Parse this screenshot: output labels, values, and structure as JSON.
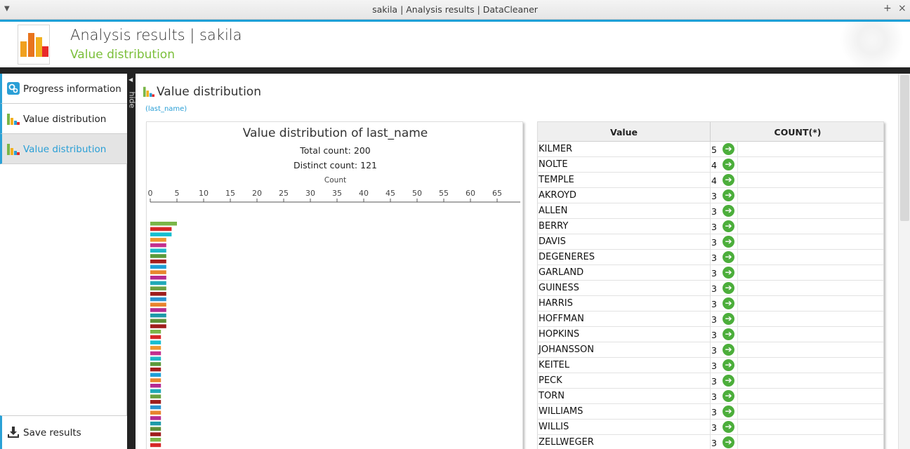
{
  "window": {
    "title": "sakila | Analysis results | DataCleaner",
    "controls": [
      "+",
      "×"
    ]
  },
  "header": {
    "title": "Analysis results  |  sakila",
    "subtitle": "Value distribution"
  },
  "sidebar": {
    "items": [
      {
        "label": "Progress information",
        "icon": "progress-gears-icon"
      },
      {
        "label": "Value distribution",
        "icon": "bar-chart-icon"
      },
      {
        "label": "Value distribution",
        "icon": "bar-chart-icon",
        "active": true
      }
    ],
    "save_label": "Save results",
    "hide_label": "hide"
  },
  "section": {
    "title": "Value distribution",
    "column_link": "(last_name)"
  },
  "chart_data": {
    "type": "bar",
    "orientation": "horizontal",
    "title": "Value distribution of last_name",
    "subtitle_total": "Total count: 200",
    "subtitle_distinct": "Distinct count: 121",
    "xlabel": "Count",
    "xlim": [
      0,
      70
    ],
    "xticks": [
      0,
      5,
      10,
      15,
      20,
      25,
      30,
      35,
      40,
      45,
      50,
      55,
      60,
      65
    ],
    "values": [
      5,
      4,
      4,
      3,
      3,
      3,
      3,
      3,
      3,
      3,
      3,
      3,
      3,
      3,
      3,
      3,
      3,
      3,
      3,
      3,
      2,
      2,
      2,
      2,
      2,
      2,
      2,
      2,
      2,
      2,
      2,
      2,
      2,
      2,
      2,
      2,
      2,
      2,
      2,
      2,
      2,
      2
    ],
    "colors": [
      "#7ab648",
      "#d62728",
      "#17becf",
      "#f0962e",
      "#c3308f",
      "#1fb6c8",
      "#5b9a3a",
      "#a61e1e",
      "#1f9fd6",
      "#e8862e",
      "#b52a92",
      "#21a9b8",
      "#6aa040",
      "#9e1d1d",
      "#2a93cf",
      "#e8842e",
      "#b52a92",
      "#1e9aa9",
      "#5d8f37",
      "#a01d1d"
    ]
  },
  "table": {
    "headers": [
      "Value",
      "COUNT(*)"
    ],
    "rows": [
      {
        "value": "KILMER",
        "count": "5"
      },
      {
        "value": "NOLTE",
        "count": "4"
      },
      {
        "value": "TEMPLE",
        "count": "4"
      },
      {
        "value": "AKROYD",
        "count": "3"
      },
      {
        "value": "ALLEN",
        "count": "3"
      },
      {
        "value": "BERRY",
        "count": "3"
      },
      {
        "value": "DAVIS",
        "count": "3"
      },
      {
        "value": "DEGENERES",
        "count": "3"
      },
      {
        "value": "GARLAND",
        "count": "3"
      },
      {
        "value": "GUINESS",
        "count": "3"
      },
      {
        "value": "HARRIS",
        "count": "3"
      },
      {
        "value": "HOFFMAN",
        "count": "3"
      },
      {
        "value": "HOPKINS",
        "count": "3"
      },
      {
        "value": "JOHANSSON",
        "count": "3"
      },
      {
        "value": "KEITEL",
        "count": "3"
      },
      {
        "value": "PECK",
        "count": "3"
      },
      {
        "value": "TORN",
        "count": "3"
      },
      {
        "value": "WILLIAMS",
        "count": "3"
      },
      {
        "value": "WILLIS",
        "count": "3"
      },
      {
        "value": "ZELLWEGER",
        "count": "3"
      }
    ],
    "drill_icon": "green-arrow-right-icon"
  }
}
